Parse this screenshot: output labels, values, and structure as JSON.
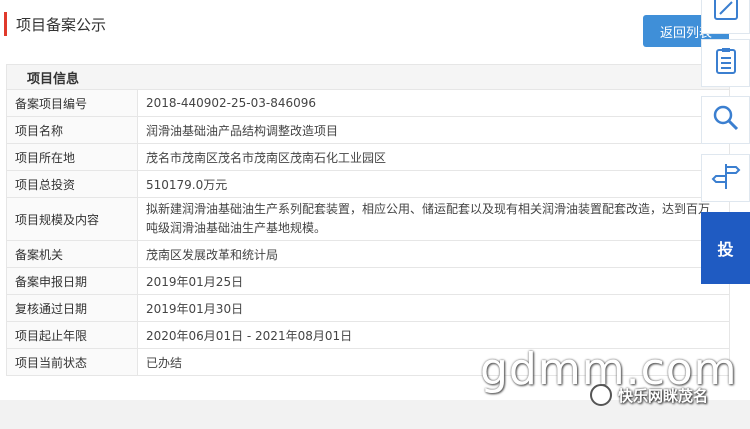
{
  "header": {
    "title": "项目备案公示",
    "back_button": "返回列表"
  },
  "section_title": "项目信息",
  "rows": [
    {
      "label": "备案项目编号",
      "value": "2018-440902-25-03-846096"
    },
    {
      "label": "项目名称",
      "value": "润滑油基础油产品结构调整改造项目"
    },
    {
      "label": "项目所在地",
      "value": "茂名市茂南区茂名市茂南区茂南石化工业园区"
    },
    {
      "label": "项目总投资",
      "value": "510179.0万元"
    },
    {
      "label": "项目规模及内容",
      "value": "拟新建润滑油基础油生产系列配套装置，相应公用、储运配套以及现有相关润滑油装置配套改造，达到百万吨级润滑油基础油生产基地规模。"
    },
    {
      "label": "备案机关",
      "value": "茂南区发展改革和统计局"
    },
    {
      "label": "备案申报日期",
      "value": "2019年01月25日"
    },
    {
      "label": "复核通过日期",
      "value": "2019年01月30日"
    },
    {
      "label": "项目起止年限",
      "value": "2020年06月01日 - 2021年08月01日"
    },
    {
      "label": "项目当前状态",
      "value": "已办结"
    }
  ],
  "side_tools": [
    "edit-icon",
    "clipboard-icon",
    "search-icon",
    "signpost-icon"
  ],
  "promo_text": "投",
  "watermark": {
    "site": "gdmm.com",
    "account": "快乐网眯茂名"
  },
  "colors": {
    "accent_red": "#e0392b",
    "button_blue": "#3f8fd8",
    "promo_blue": "#1f5bc2"
  }
}
